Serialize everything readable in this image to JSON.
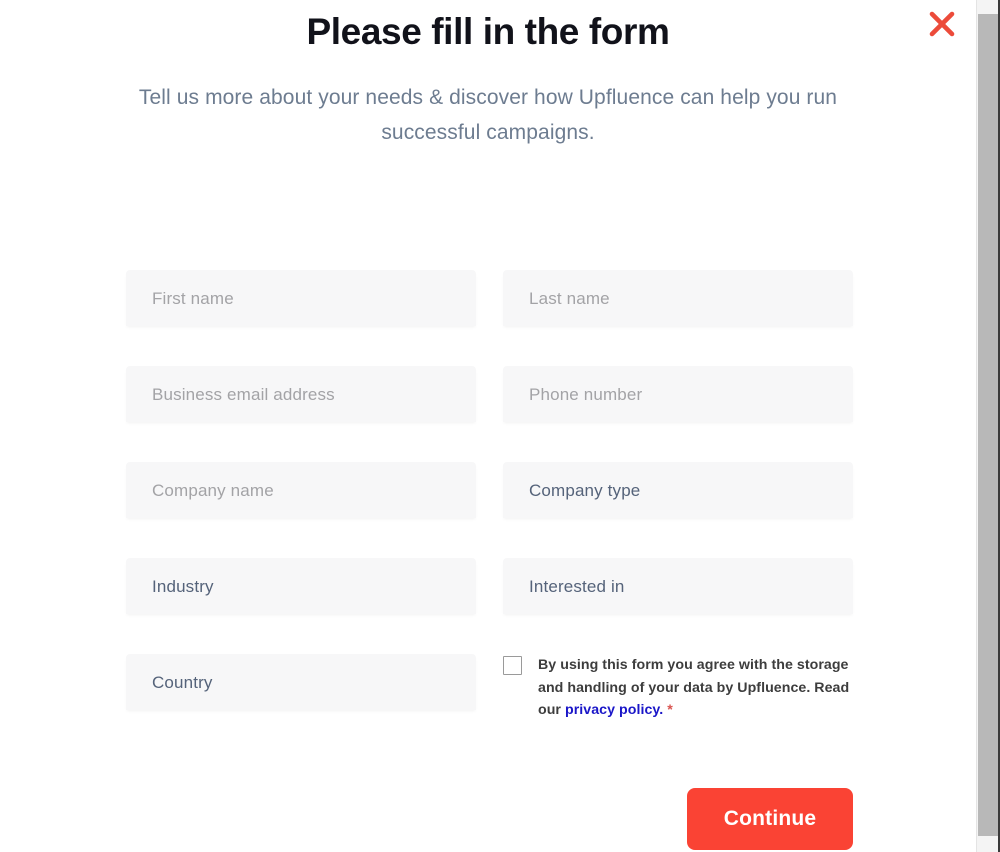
{
  "header": {
    "title": "Please fill in the form",
    "subtitle": "Tell us more about your needs & discover how Upfluence can help you run successful campaigns.",
    "close_icon": "close-icon"
  },
  "form": {
    "rows": [
      {
        "left": {
          "kind": "input",
          "name": "first-name",
          "text": "First name"
        },
        "right": {
          "kind": "input",
          "name": "last-name",
          "text": "Last name"
        }
      },
      {
        "left": {
          "kind": "input",
          "name": "business-email",
          "text": "Business email address"
        },
        "right": {
          "kind": "input",
          "name": "phone-number",
          "text": "Phone number"
        }
      },
      {
        "left": {
          "kind": "input",
          "name": "company-name",
          "text": "Company name"
        },
        "right": {
          "kind": "select",
          "name": "company-type",
          "text": "Company type"
        }
      },
      {
        "left": {
          "kind": "select",
          "name": "industry",
          "text": "Industry"
        },
        "right": {
          "kind": "select",
          "name": "interested-in",
          "text": "Interested in"
        }
      }
    ],
    "country": {
      "kind": "select",
      "name": "country",
      "text": "Country"
    }
  },
  "consent": {
    "checked": false,
    "text_before_link": "By using this form you agree with the storage and handling of your data by Upfluence. Read our ",
    "link_text": "privacy policy.",
    "required_mark": "*"
  },
  "footer": {
    "continue_label": "Continue"
  },
  "colors": {
    "accent_red": "#fa4334",
    "close_red": "#ec4b3a",
    "link_blue": "#1a16c8",
    "subtitle_gray": "#6d7c90",
    "field_bg": "#f7f7f8",
    "placeholder_gray": "#a3a3a6",
    "select_text": "#55637a",
    "required_red": "#d9534f"
  }
}
